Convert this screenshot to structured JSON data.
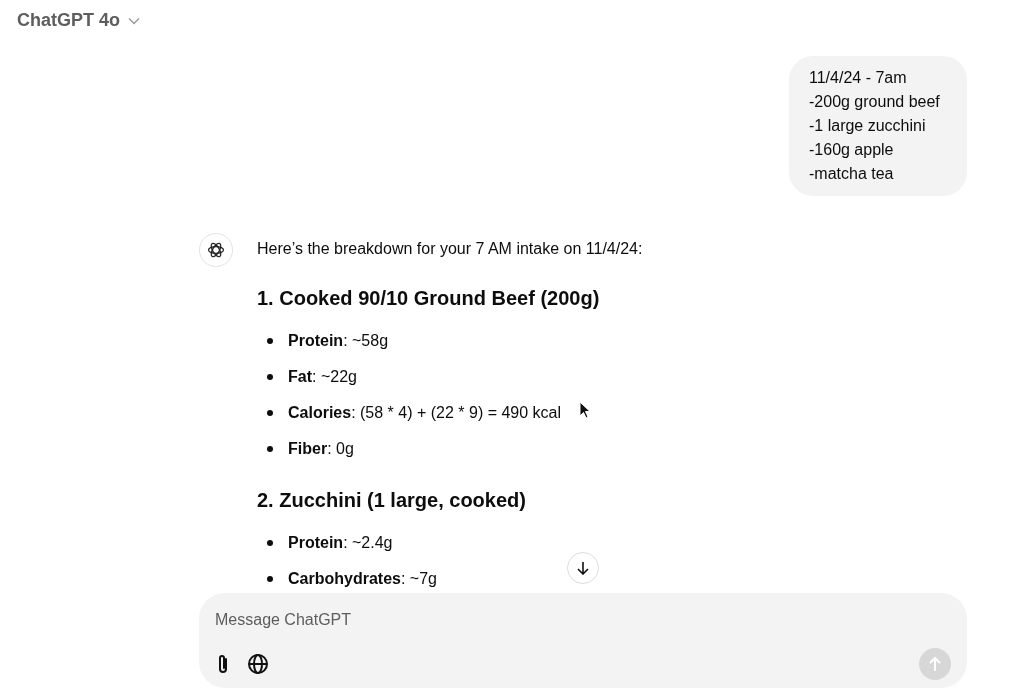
{
  "header": {
    "model_label": "ChatGPT 4o"
  },
  "user_message": {
    "lines": [
      "11/4/24 - 7am",
      "-200g ground beef",
      "-1 large zucchini",
      "-160g apple",
      "-matcha tea"
    ]
  },
  "assistant_message": {
    "intro": "Here’s the breakdown for your 7 AM intake on 11/4/24:",
    "sections": [
      {
        "heading": "1. Cooked 90/10 Ground Beef (200g)",
        "items": [
          "**Protein**: ~58g",
          "**Fat**: ~22g",
          "**Calories**: (58 * 4) + (22 * 9) = 490 kcal",
          "**Fiber**: 0g"
        ]
      },
      {
        "heading": "2. Zucchini (1 large, cooked)",
        "items": [
          "**Protein**: ~2.4g",
          "**Carbohydrates**: ~7g"
        ]
      }
    ]
  },
  "composer": {
    "placeholder": "Message ChatGPT",
    "send_disabled": true
  }
}
